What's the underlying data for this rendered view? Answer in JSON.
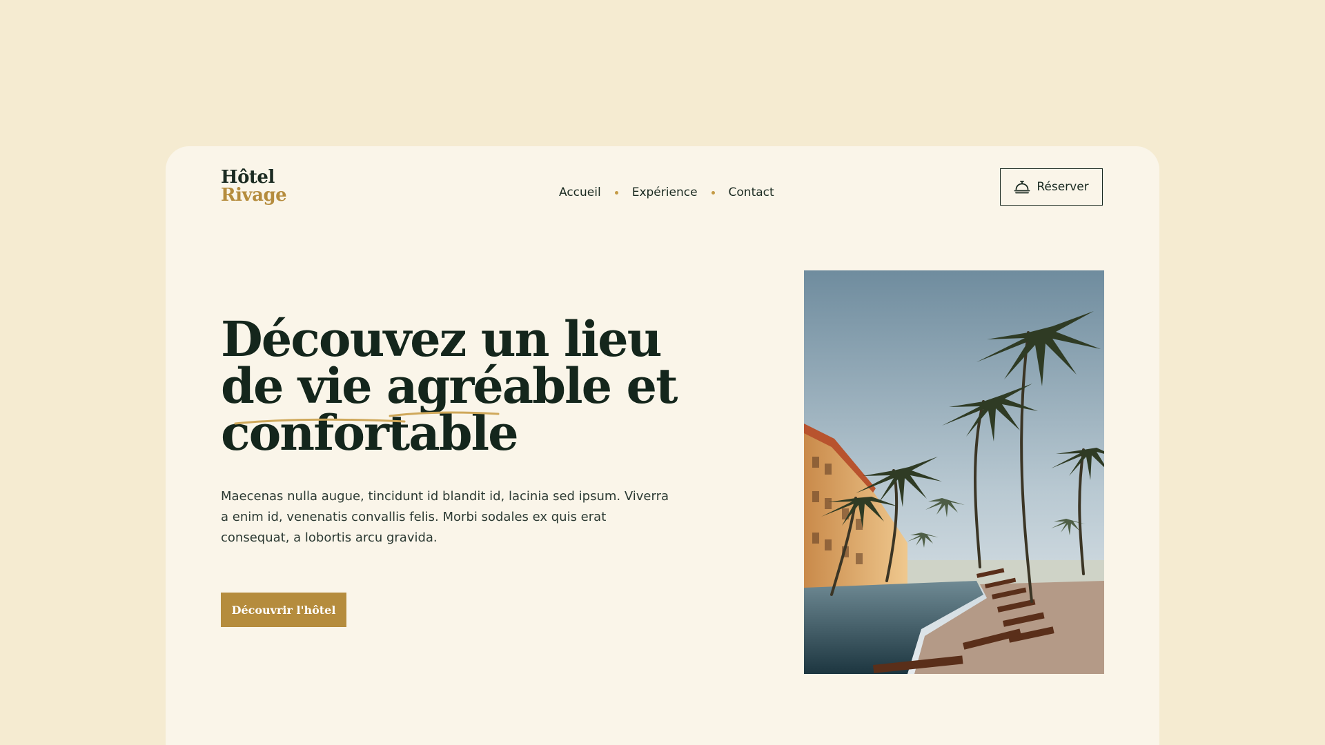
{
  "brand": {
    "line1": "Hôtel",
    "line2": "Rivage"
  },
  "nav": {
    "items": [
      {
        "label": "Accueil"
      },
      {
        "label": "Expérience"
      },
      {
        "label": "Contact"
      }
    ]
  },
  "header": {
    "reserve_label": "Réserver",
    "reserve_icon": "service-bell-icon"
  },
  "hero": {
    "title_lines": [
      "Découvez un lieu",
      "de vie agréable et",
      "confortable"
    ],
    "description": "Maecenas nulla augue, tincidunt id blandit id, lacinia sed ipsum. Viverra a enim id, venenatis convallis felis. Morbi sodales ex quis erat consequat, a lobortis arcu gravida.",
    "cta_label": "Découvrir l'hôtel"
  },
  "colors": {
    "page_background": "#f5ebd1",
    "card_background": "#faf5e9",
    "text_dark": "#1a2a21",
    "accent_gold": "#b58c3d"
  }
}
